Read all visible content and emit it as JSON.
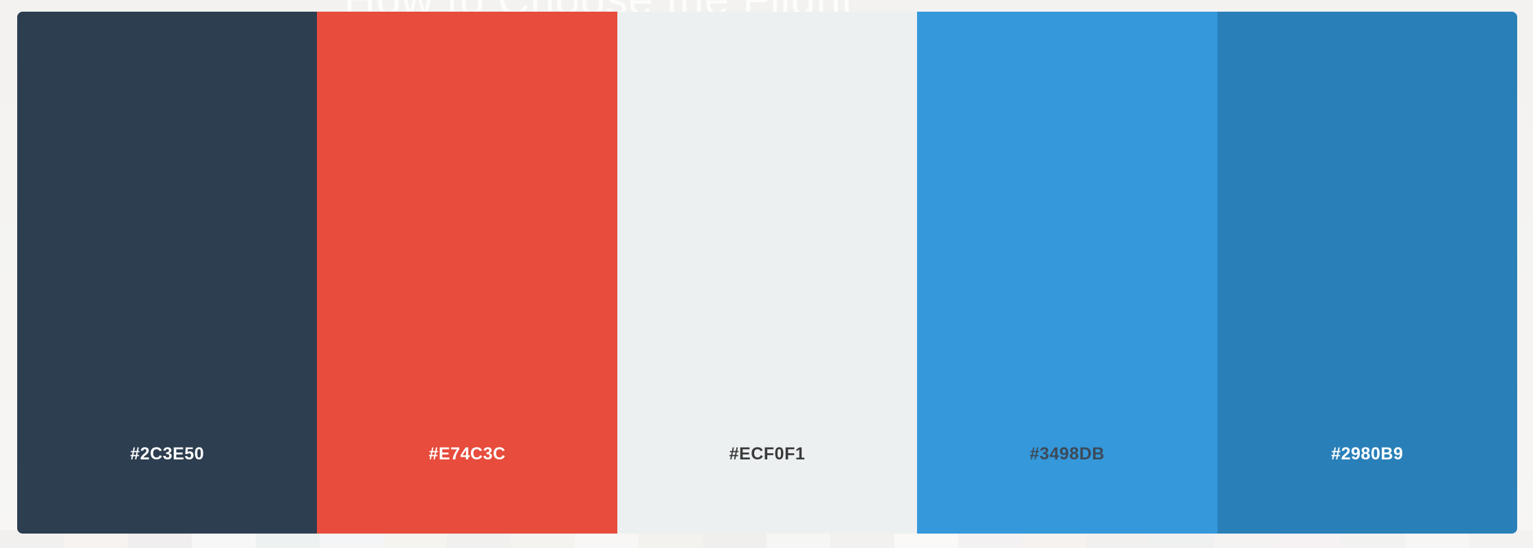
{
  "background": {
    "heading": "How to Choose the Flight"
  },
  "palette": {
    "swatches": [
      {
        "hex": "#2C3E50",
        "color": "#2c3e50",
        "text_color": "#ffffff"
      },
      {
        "hex": "#E74C3C",
        "color": "#e74c3c",
        "text_color": "#ffffff"
      },
      {
        "hex": "#ECF0F1",
        "color": "#ecf0f1",
        "text_color": "#3a3a3a"
      },
      {
        "hex": "#3498DB",
        "color": "#3498db",
        "text_color": "#3d4a58"
      },
      {
        "hex": "#2980B9",
        "color": "#2980b9",
        "text_color": "#ffffff"
      }
    ]
  }
}
